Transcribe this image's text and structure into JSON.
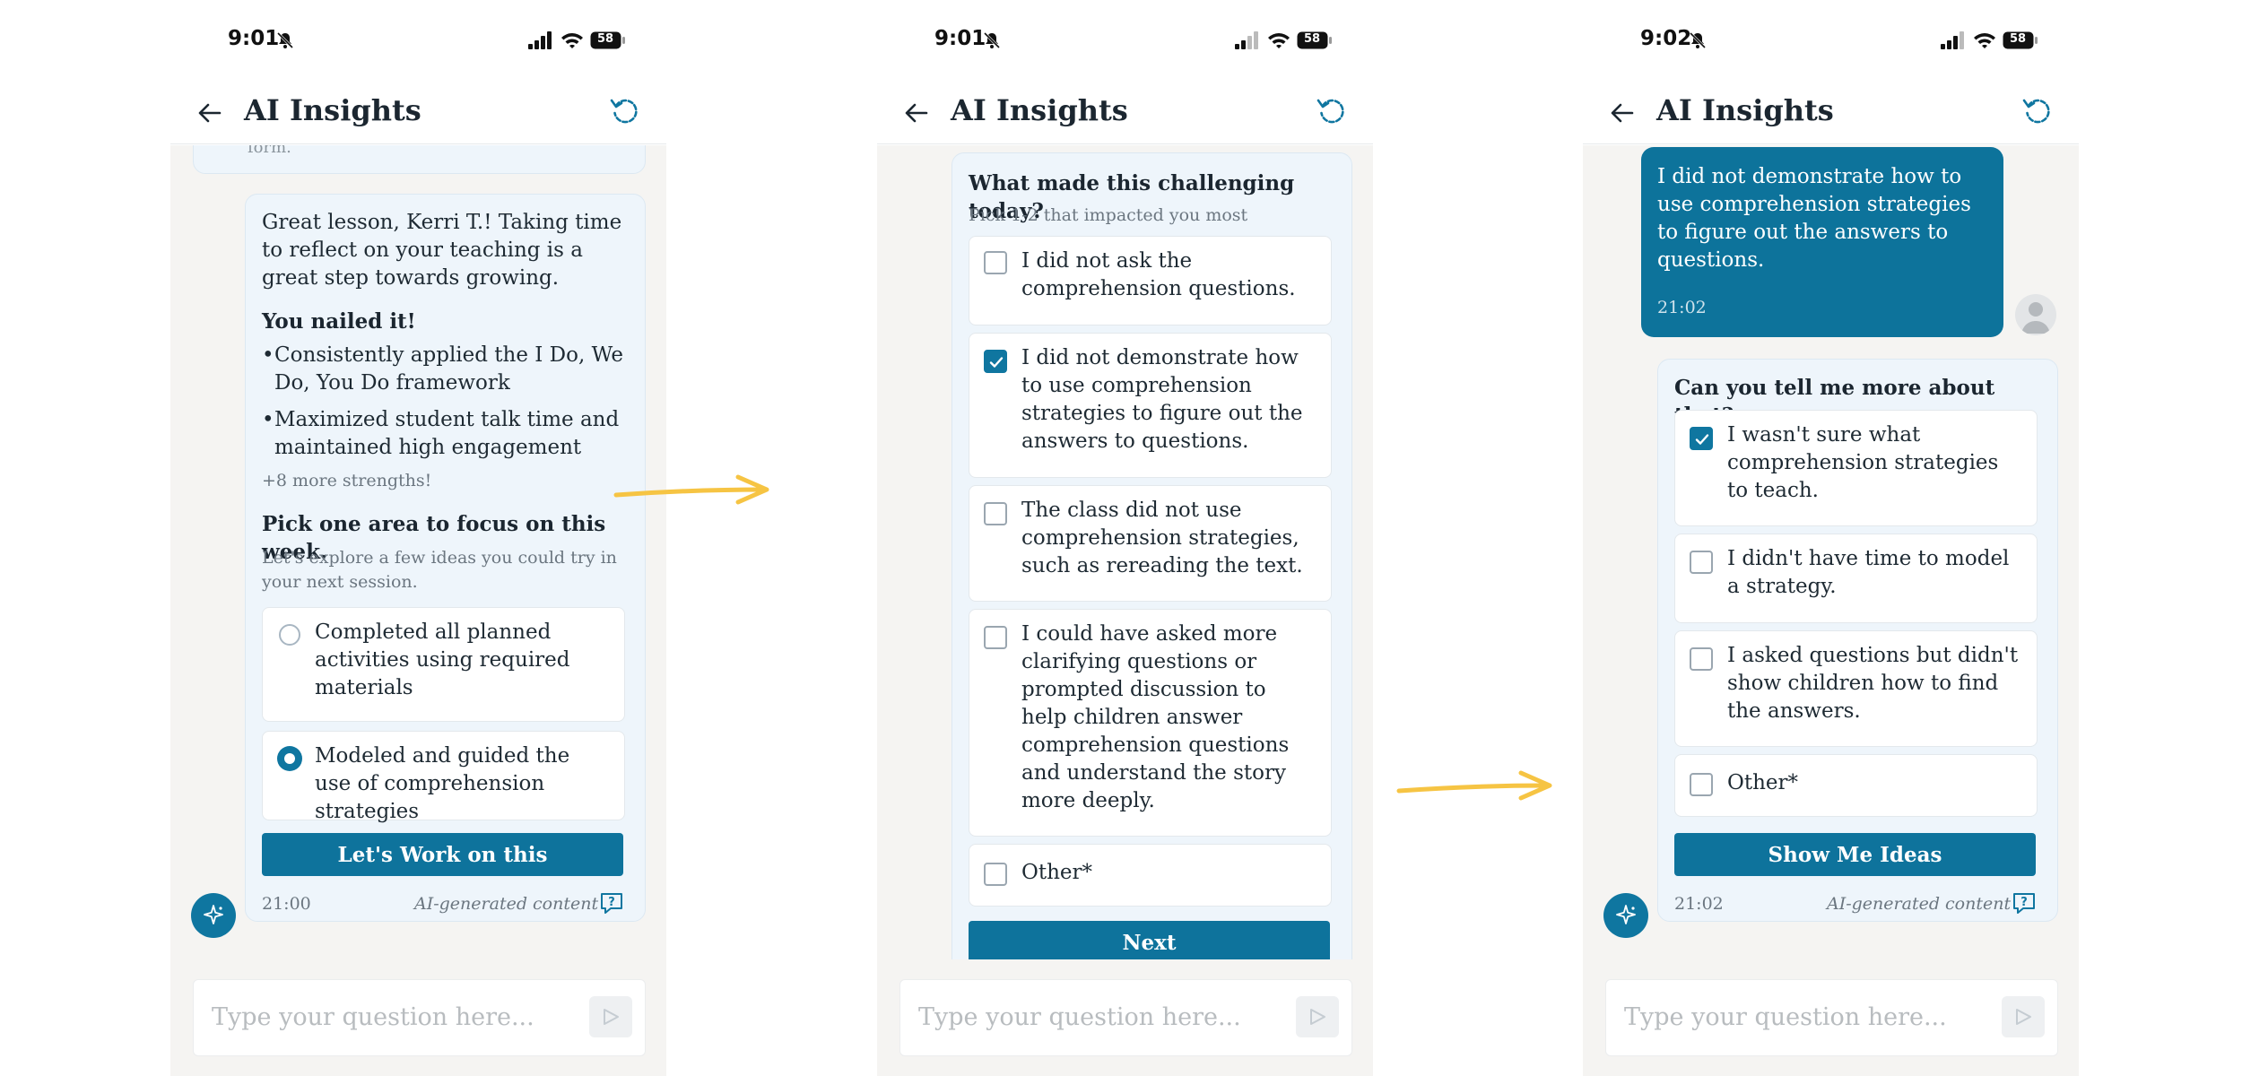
{
  "status_bar": {
    "battery": "58",
    "phone_times": [
      "9:01",
      "9:01",
      "9:02"
    ]
  },
  "header": {
    "title": "AI Insights"
  },
  "input": {
    "placeholder": "Type your question here..."
  },
  "screen1": {
    "partial_text": "form.",
    "greeting": "Great lesson, Kerri T.! Taking time to reflect on your teaching is a great step towards growing.",
    "nailed_heading": "You nailed it!",
    "bullets": [
      "Consistently applied the I Do, We Do, You Do framework",
      "Maximized student talk time and maintained high engagement"
    ],
    "more_strengths": "+8 more strengths!",
    "focus_heading": "Pick one area to focus on this week.",
    "focus_sub": "Let's explore a few ideas you could try in your next session.",
    "options": [
      {
        "label": "Completed all planned activities using required materials",
        "selected": false
      },
      {
        "label": "Modeled and guided the use of comprehension strategies",
        "selected": true
      }
    ],
    "button": "Let's Work on this",
    "time": "21:00",
    "ai_label": "AI-generated content"
  },
  "screen2": {
    "question": "What made this challenging today?",
    "sub": "Pick 1-2 that impacted you most",
    "options": [
      {
        "label": "I did not ask the comprehension questions.",
        "checked": false
      },
      {
        "label": "I did not demonstrate how to use comprehension strategies to figure out the answers to questions.",
        "checked": true
      },
      {
        "label": "The class did not use comprehension strategies, such as rereading the text.",
        "checked": false
      },
      {
        "label": "I could have asked more clarifying questions or prompted discussion to help children answer comprehension questions and understand the story more deeply.",
        "checked": false
      },
      {
        "label": "Other*",
        "checked": false
      }
    ],
    "button": "Next"
  },
  "screen3": {
    "user_message": "I did not demonstrate how to use comprehension strategies to figure out the answers to questions.",
    "user_time": "21:02",
    "question": "Can you tell me more about that?",
    "options": [
      {
        "label": "I wasn't sure what comprehension strategies to teach.",
        "checked": true
      },
      {
        "label": "I didn't have time to model a strategy.",
        "checked": false
      },
      {
        "label": "I asked questions but didn't show children how to find the answers.",
        "checked": false
      },
      {
        "label": "Other*",
        "checked": false
      }
    ],
    "button": "Show Me Ideas",
    "time": "21:02",
    "ai_label": "AI-generated content"
  },
  "colors": {
    "accent": "#0e739c",
    "card_bg": "#eef5fb",
    "chat_bg": "#f5f4f2",
    "arrow": "#f6c443"
  },
  "icons": [
    "back-arrow-icon",
    "refresh-icon",
    "bell-off-icon",
    "signal-icon",
    "wifi-icon",
    "battery-icon",
    "send-icon",
    "sparkle-icon",
    "feedback-icon",
    "checkmark-icon",
    "person-icon",
    "arrow-icon"
  ]
}
